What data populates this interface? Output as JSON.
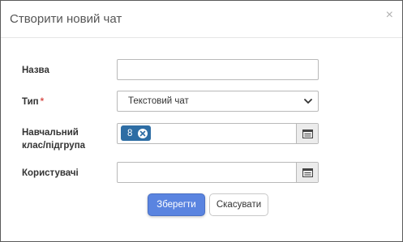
{
  "dialog": {
    "title": "Створити новий чат",
    "close_glyph": "×"
  },
  "form": {
    "name": {
      "label": "Назва",
      "value": ""
    },
    "type": {
      "label": "Тип",
      "required_mark": "*",
      "value": "Текстовий чат"
    },
    "group": {
      "label_line1": "Навчальний",
      "label_line2": "клас/підгрупа",
      "tags": [
        "8"
      ]
    },
    "users": {
      "label": "Користувачі",
      "value": ""
    }
  },
  "buttons": {
    "save": "Зберегти",
    "cancel": "Скасувати"
  },
  "icons": {
    "close": "close-icon",
    "select_arrow": "chevron-down-icon",
    "tag_remove": "x-circle-icon",
    "lookup": "list-icon"
  },
  "colors": {
    "primary": "#5a84e0",
    "tag": "#2e6da4",
    "required": "#d9534f"
  }
}
